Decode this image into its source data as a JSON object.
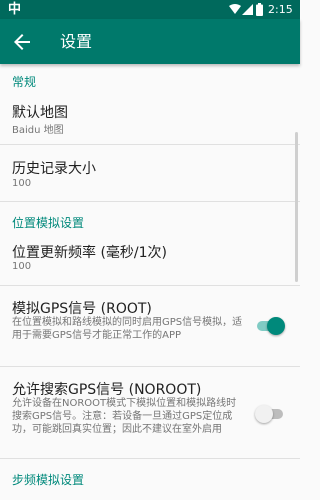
{
  "status_bar": {
    "app_glyph": "中",
    "time": "2:15",
    "icons": [
      "wifi-icon",
      "signal-icon",
      "battery-icon"
    ]
  },
  "app_bar": {
    "title": "设置",
    "back_icon": "arrow-back-icon"
  },
  "colors": {
    "status_bar": "#00695c",
    "app_bar": "#00796b",
    "accent": "#00897b",
    "switch_on_track": "#80cbc4"
  },
  "sections": {
    "general": {
      "header": "常规",
      "default_map": {
        "title": "默认地图",
        "value": "Baidu 地图"
      },
      "history_size": {
        "title": "历史记录大小",
        "value": "100"
      }
    },
    "location_sim": {
      "header": "位置模拟设置",
      "update_freq": {
        "title": "位置更新频率 (毫秒/1次)",
        "value": "100"
      },
      "gps_root": {
        "title": "模拟GPS信号 (ROOT)",
        "summary": "在位置模拟和路线模拟的同时启用GPS信号模拟，适用于需要GPS信号才能正常工作的APP",
        "enabled": true
      },
      "gps_noroot": {
        "title": "允许搜索GPS信号 (NOROOT)",
        "summary": "允许设备在NOROOT模式下模拟位置和模拟路线时搜索GPS信号。注意：若设备一旦通过GPS定位成功，可能跳回真实位置；因此不建议在室外启用",
        "enabled": false
      }
    },
    "step_sim": {
      "header": "步频模拟设置"
    }
  }
}
